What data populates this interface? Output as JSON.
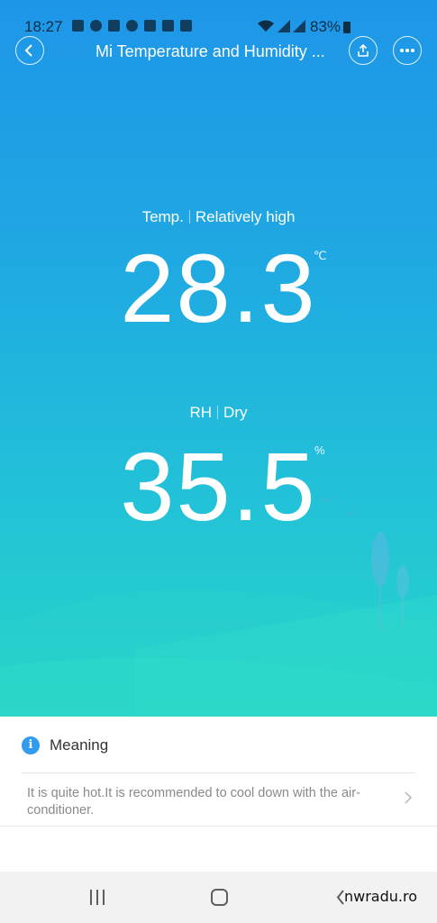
{
  "status_bar": {
    "time": "18:27",
    "battery": "83%"
  },
  "header": {
    "title": "Mi Temperature and Humidity ...",
    "back_icon": "chevron-left-icon",
    "share_icon": "share-icon",
    "more_icon": "more-dots-icon"
  },
  "temperature": {
    "label": "Temp.",
    "status": "Relatively high",
    "value": "28.3",
    "unit": "℃"
  },
  "humidity": {
    "label": "RH",
    "status": "Dry",
    "value": "35.5",
    "unit": "%"
  },
  "info_card": {
    "title": "Meaning",
    "advice": "It is quite hot.It is recommended to cool down with the air-conditioner."
  },
  "nav_bar": {
    "watermark": "nwradu.ro"
  },
  "colors": {
    "gradient_top": "#1e96e8",
    "gradient_bottom": "#27d6c6",
    "info_accent": "#2f9cf0"
  }
}
